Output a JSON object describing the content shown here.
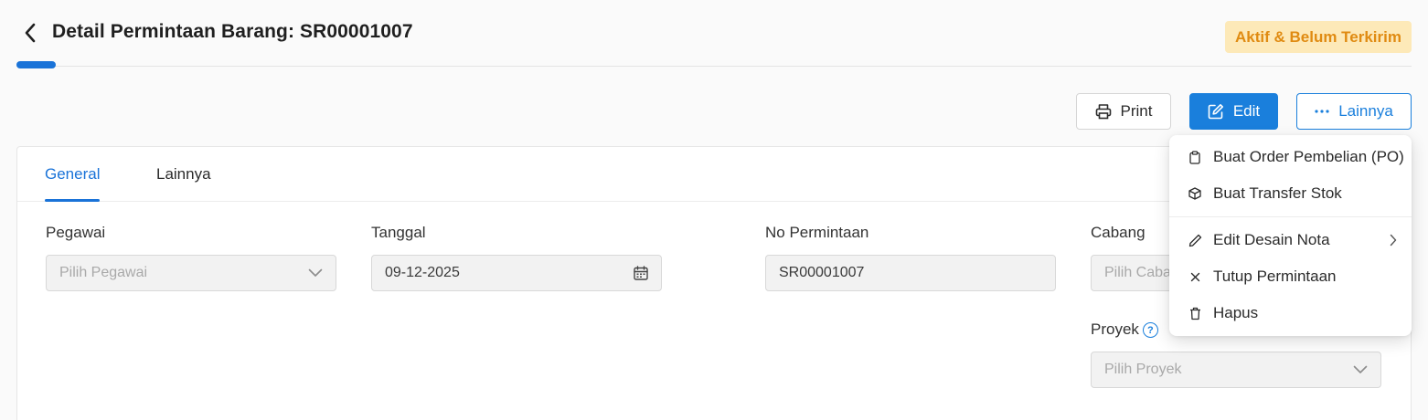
{
  "header": {
    "title": "Detail Permintaan Barang: SR00001007",
    "status_badge": "Aktif & Belum Terkirim",
    "status_color": "#e08b12",
    "accent_color": "#1a73d8"
  },
  "actions": {
    "print_label": "Print",
    "edit_label": "Edit",
    "more_label": "Lainnya"
  },
  "tabs": [
    {
      "label": "General",
      "active": true
    },
    {
      "label": "Lainnya",
      "active": false
    }
  ],
  "form": {
    "pegawai": {
      "label": "Pegawai",
      "placeholder": "Pilih Pegawai"
    },
    "tanggal": {
      "label": "Tanggal",
      "value": "09-12-2025"
    },
    "no_permintaan": {
      "label": "No Permintaan",
      "value": "SR00001007"
    },
    "cabang": {
      "label": "Cabang",
      "placeholder": "Pilih Caba"
    },
    "proyek": {
      "label": "Proyek",
      "placeholder": "Pilih Proyek",
      "help": "?"
    }
  },
  "menu": {
    "items": [
      {
        "label": "Buat Order Pembelian (PO)",
        "icon": "clipboard-icon"
      },
      {
        "label": "Buat Transfer Stok",
        "icon": "box-icon"
      },
      {
        "label": "Edit Desain Nota",
        "icon": "pencil-icon",
        "submenu": true
      },
      {
        "label": "Tutup Permintaan",
        "icon": "close-icon"
      },
      {
        "label": "Hapus",
        "icon": "trash-icon"
      }
    ]
  }
}
